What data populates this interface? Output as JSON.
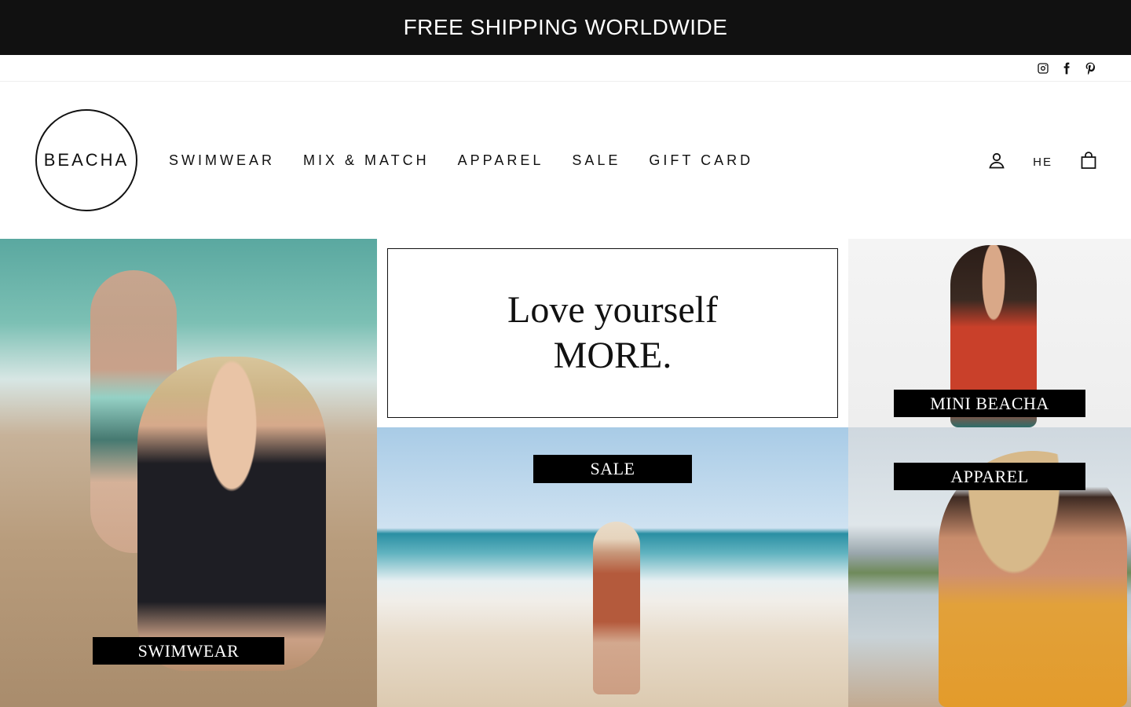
{
  "announcement": {
    "text": "FREE SHIPPING WORLDWIDE"
  },
  "social": [
    {
      "name": "instagram-icon"
    },
    {
      "name": "facebook-icon"
    },
    {
      "name": "pinterest-icon"
    }
  ],
  "header": {
    "logo_text": "BEACHA",
    "nav": [
      "SWIMWEAR",
      "MIX & MATCH",
      "APPAREL",
      "SALE",
      "GIFT CARD"
    ],
    "language": "HE",
    "icons": [
      "account-icon",
      "cart-icon"
    ]
  },
  "tiles": {
    "swimwear": "SWIMWEAR",
    "quote_line1": "Love yourself",
    "quote_line2": "MORE.",
    "mini": "MINI  BEACHA",
    "sale": "SALE",
    "apparel": "APPAREL"
  }
}
